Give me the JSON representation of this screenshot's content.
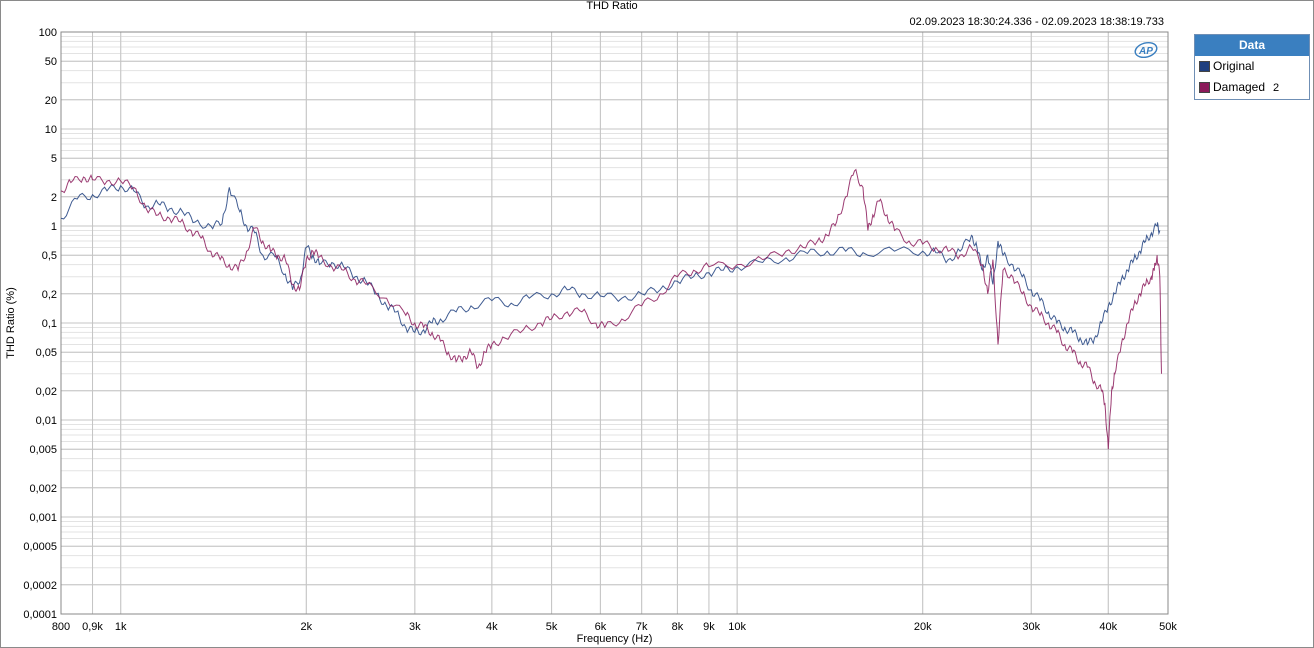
{
  "chart_data": {
    "type": "line",
    "title": "THD Ratio",
    "subtitle": "02.09.2023 18:30:24.336 - 02.09.2023 18:38:19.733",
    "xlabel": "Frequency (Hz)",
    "ylabel": "THD Ratio (%)",
    "x_scale": "log",
    "y_scale": "log",
    "xlim": [
      800,
      50000
    ],
    "ylim": [
      0.0001,
      100
    ],
    "grid": true,
    "legend_title": "Data",
    "legend_position": "right",
    "x_ticks": [
      {
        "value": 800,
        "label": "800"
      },
      {
        "value": 900,
        "label": "0,9k"
      },
      {
        "value": 1000,
        "label": "1k"
      },
      {
        "value": 2000,
        "label": "2k"
      },
      {
        "value": 3000,
        "label": "3k"
      },
      {
        "value": 4000,
        "label": "4k"
      },
      {
        "value": 5000,
        "label": "5k"
      },
      {
        "value": 6000,
        "label": "6k"
      },
      {
        "value": 7000,
        "label": "7k"
      },
      {
        "value": 8000,
        "label": "8k"
      },
      {
        "value": 9000,
        "label": "9k"
      },
      {
        "value": 10000,
        "label": "10k"
      },
      {
        "value": 20000,
        "label": "20k"
      },
      {
        "value": 30000,
        "label": "30k"
      },
      {
        "value": 40000,
        "label": "40k"
      },
      {
        "value": 50000,
        "label": "50k"
      }
    ],
    "y_ticks": [
      {
        "value": 100,
        "label": "100"
      },
      {
        "value": 50,
        "label": "50"
      },
      {
        "value": 20,
        "label": "20"
      },
      {
        "value": 10,
        "label": "10"
      },
      {
        "value": 5,
        "label": "5"
      },
      {
        "value": 2,
        "label": "2"
      },
      {
        "value": 1,
        "label": "1"
      },
      {
        "value": 0.5,
        "label": "0,5"
      },
      {
        "value": 0.2,
        "label": "0,2"
      },
      {
        "value": 0.1,
        "label": "0,1"
      },
      {
        "value": 0.05,
        "label": "0,05"
      },
      {
        "value": 0.02,
        "label": "0,02"
      },
      {
        "value": 0.01,
        "label": "0,01"
      },
      {
        "value": 0.005,
        "label": "0,005"
      },
      {
        "value": 0.002,
        "label": "0,002"
      },
      {
        "value": 0.001,
        "label": "0,001"
      },
      {
        "value": 0.0005,
        "label": "0,0005"
      },
      {
        "value": 0.0002,
        "label": "0,0002"
      },
      {
        "value": 0.0001,
        "label": "0,0001"
      }
    ],
    "series": [
      {
        "name": "Original",
        "color": "#1f3f7f",
        "points": [
          [
            800,
            1.2
          ],
          [
            850,
            1.9
          ],
          [
            900,
            2.1
          ],
          [
            950,
            2.3
          ],
          [
            1000,
            2.6
          ],
          [
            1050,
            2.3
          ],
          [
            1100,
            1.6
          ],
          [
            1150,
            1.7
          ],
          [
            1200,
            1.5
          ],
          [
            1260,
            1.4
          ],
          [
            1320,
            1.1
          ],
          [
            1400,
            1.0
          ],
          [
            1460,
            1.05
          ],
          [
            1500,
            2.5
          ],
          [
            1560,
            1.4
          ],
          [
            1600,
            1.0
          ],
          [
            1650,
            0.85
          ],
          [
            1700,
            0.5
          ],
          [
            1780,
            0.48
          ],
          [
            1850,
            0.32
          ],
          [
            1900,
            0.22
          ],
          [
            1960,
            0.3
          ],
          [
            2000,
            0.6
          ],
          [
            2050,
            0.5
          ],
          [
            2100,
            0.4
          ],
          [
            2200,
            0.42
          ],
          [
            2300,
            0.38
          ],
          [
            2400,
            0.3
          ],
          [
            2500,
            0.27
          ],
          [
            2600,
            0.2
          ],
          [
            2700,
            0.15
          ],
          [
            2800,
            0.13
          ],
          [
            2900,
            0.09
          ],
          [
            3000,
            0.08
          ],
          [
            3100,
            0.085
          ],
          [
            3200,
            0.1
          ],
          [
            3300,
            0.11
          ],
          [
            3500,
            0.13
          ],
          [
            3700,
            0.15
          ],
          [
            4000,
            0.17
          ],
          [
            4300,
            0.16
          ],
          [
            4600,
            0.18
          ],
          [
            5000,
            0.2
          ],
          [
            5300,
            0.22
          ],
          [
            5600,
            0.2
          ],
          [
            6000,
            0.19
          ],
          [
            6500,
            0.18
          ],
          [
            7000,
            0.2
          ],
          [
            7500,
            0.22
          ],
          [
            8000,
            0.27
          ],
          [
            8500,
            0.3
          ],
          [
            9000,
            0.33
          ],
          [
            9500,
            0.35
          ],
          [
            10000,
            0.38
          ],
          [
            11000,
            0.42
          ],
          [
            12000,
            0.47
          ],
          [
            13000,
            0.52
          ],
          [
            14000,
            0.55
          ],
          [
            15000,
            0.55
          ],
          [
            16000,
            0.53
          ],
          [
            18000,
            0.55
          ],
          [
            20000,
            0.55
          ],
          [
            21000,
            0.53
          ],
          [
            22000,
            0.45
          ],
          [
            23000,
            0.55
          ],
          [
            24000,
            0.8
          ],
          [
            24500,
            0.6
          ],
          [
            25000,
            0.35
          ],
          [
            25500,
            0.5
          ],
          [
            26000,
            0.25
          ],
          [
            26500,
            0.7
          ],
          [
            27000,
            0.5
          ],
          [
            28000,
            0.4
          ],
          [
            29000,
            0.3
          ],
          [
            30000,
            0.22
          ],
          [
            31000,
            0.17
          ],
          [
            32000,
            0.13
          ],
          [
            33000,
            0.1
          ],
          [
            34000,
            0.09
          ],
          [
            35000,
            0.08
          ],
          [
            36000,
            0.07
          ],
          [
            37000,
            0.06
          ],
          [
            38000,
            0.07
          ],
          [
            39000,
            0.1
          ],
          [
            40000,
            0.15
          ],
          [
            41000,
            0.2
          ],
          [
            42000,
            0.28
          ],
          [
            43000,
            0.35
          ],
          [
            44000,
            0.45
          ],
          [
            45000,
            0.55
          ],
          [
            46000,
            0.7
          ],
          [
            47000,
            0.85
          ],
          [
            48000,
            1.0
          ],
          [
            48500,
            0.9
          ]
        ]
      },
      {
        "name": "Damaged",
        "suffix": "2",
        "color": "#8b1a5a",
        "points": [
          [
            800,
            2.3
          ],
          [
            830,
            2.8
          ],
          [
            870,
            3.2
          ],
          [
            900,
            3.0
          ],
          [
            950,
            2.9
          ],
          [
            1000,
            2.9
          ],
          [
            1050,
            2.5
          ],
          [
            1100,
            1.5
          ],
          [
            1150,
            1.3
          ],
          [
            1200,
            1.2
          ],
          [
            1250,
            1.1
          ],
          [
            1300,
            0.9
          ],
          [
            1350,
            0.75
          ],
          [
            1400,
            0.55
          ],
          [
            1450,
            0.45
          ],
          [
            1500,
            0.4
          ],
          [
            1550,
            0.35
          ],
          [
            1600,
            0.55
          ],
          [
            1650,
            0.95
          ],
          [
            1700,
            0.7
          ],
          [
            1750,
            0.55
          ],
          [
            1800,
            0.5
          ],
          [
            1850,
            0.45
          ],
          [
            1900,
            0.25
          ],
          [
            1950,
            0.22
          ],
          [
            2000,
            0.45
          ],
          [
            2050,
            0.55
          ],
          [
            2100,
            0.48
          ],
          [
            2200,
            0.38
          ],
          [
            2300,
            0.35
          ],
          [
            2400,
            0.28
          ],
          [
            2500,
            0.25
          ],
          [
            2700,
            0.18
          ],
          [
            2900,
            0.12
          ],
          [
            3000,
            0.1
          ],
          [
            3100,
            0.09
          ],
          [
            3200,
            0.08
          ],
          [
            3300,
            0.065
          ],
          [
            3400,
            0.05
          ],
          [
            3500,
            0.04
          ],
          [
            3600,
            0.045
          ],
          [
            3700,
            0.05
          ],
          [
            3800,
            0.035
          ],
          [
            3900,
            0.05
          ],
          [
            4000,
            0.06
          ],
          [
            4200,
            0.07
          ],
          [
            4500,
            0.085
          ],
          [
            4800,
            0.1
          ],
          [
            5000,
            0.11
          ],
          [
            5300,
            0.13
          ],
          [
            5600,
            0.13
          ],
          [
            5900,
            0.1
          ],
          [
            6100,
            0.09
          ],
          [
            6500,
            0.11
          ],
          [
            7000,
            0.15
          ],
          [
            7500,
            0.2
          ],
          [
            8000,
            0.3
          ],
          [
            8500,
            0.35
          ],
          [
            9000,
            0.38
          ],
          [
            10000,
            0.4
          ],
          [
            11000,
            0.45
          ],
          [
            12000,
            0.55
          ],
          [
            12800,
            0.6
          ],
          [
            13500,
            0.7
          ],
          [
            14000,
            0.8
          ],
          [
            14500,
            1.1
          ],
          [
            15000,
            2.0
          ],
          [
            15500,
            3.7
          ],
          [
            16000,
            2.5
          ],
          [
            16300,
            0.9
          ],
          [
            16600,
            1.3
          ],
          [
            17000,
            1.8
          ],
          [
            17500,
            1.3
          ],
          [
            18000,
            0.9
          ],
          [
            19000,
            0.7
          ],
          [
            20000,
            0.65
          ],
          [
            21000,
            0.6
          ],
          [
            22000,
            0.55
          ],
          [
            23000,
            0.5
          ],
          [
            24000,
            0.6
          ],
          [
            25000,
            0.4
          ],
          [
            25500,
            0.2
          ],
          [
            26000,
            0.45
          ],
          [
            26500,
            0.06
          ],
          [
            27000,
            0.35
          ],
          [
            28000,
            0.3
          ],
          [
            29000,
            0.2
          ],
          [
            30000,
            0.15
          ],
          [
            31000,
            0.12
          ],
          [
            32000,
            0.1
          ],
          [
            33000,
            0.08
          ],
          [
            34000,
            0.06
          ],
          [
            35000,
            0.05
          ],
          [
            36000,
            0.04
          ],
          [
            37000,
            0.035
          ],
          [
            38000,
            0.025
          ],
          [
            39000,
            0.02
          ],
          [
            39500,
            0.015
          ],
          [
            40000,
            0.005
          ],
          [
            40500,
            0.02
          ],
          [
            41000,
            0.03
          ],
          [
            42000,
            0.06
          ],
          [
            43000,
            0.1
          ],
          [
            44000,
            0.15
          ],
          [
            45000,
            0.2
          ],
          [
            46000,
            0.25
          ],
          [
            47000,
            0.3
          ],
          [
            47500,
            0.35
          ],
          [
            48000,
            0.5
          ],
          [
            48500,
            0.3
          ],
          [
            48800,
            0.03
          ]
        ]
      }
    ]
  }
}
